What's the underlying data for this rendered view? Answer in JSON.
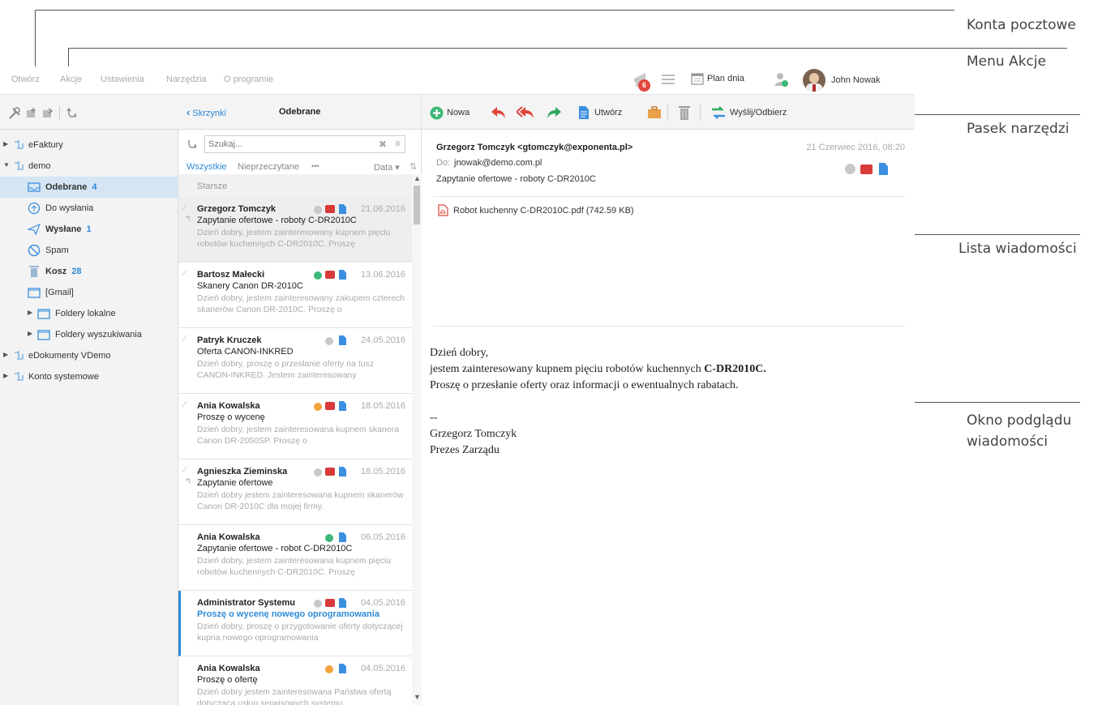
{
  "callouts": {
    "konta": "Konta pocztowe",
    "menu": "Menu Akcje",
    "pasek": "Pasek narzędzi",
    "lista": "Lista wiadomości",
    "okno_line1": "Okno podglądu",
    "okno_line2": "wiadomości"
  },
  "menu": [
    "Otwórz",
    "Akcje",
    "Ustawienia",
    "Narzędzia",
    "O programie"
  ],
  "header": {
    "notif_count": "6",
    "plan_label": "Plan dnia",
    "user_name": "John Nowak"
  },
  "list_header": {
    "back_label": "Skrzynki",
    "title": "Odebrane",
    "search_placeholder": "Szukaj...",
    "filter_all": "Wszystkie",
    "filter_unread": "Nieprzeczytane",
    "filter_more": "•••",
    "sort_label": "Data ▾",
    "group_label": "Starsze"
  },
  "tree": [
    {
      "label": "eFaktury",
      "count": ""
    },
    {
      "label": "demo",
      "count": ""
    },
    {
      "label": "Odebrane",
      "count": "4"
    },
    {
      "label": "Do wysłania",
      "count": ""
    },
    {
      "label": "Wysłane",
      "count": "1"
    },
    {
      "label": "Spam",
      "count": ""
    },
    {
      "label": "Kosz",
      "count": "28"
    },
    {
      "label": "[Gmail]",
      "count": ""
    },
    {
      "label": "Foldery lokalne",
      "count": ""
    },
    {
      "label": "Foldery wyszukiwania",
      "count": ""
    },
    {
      "label": "eDokumenty VDemo",
      "count": ""
    },
    {
      "label": "Konto systemowe",
      "count": ""
    }
  ],
  "messages": [
    {
      "from": "Grzegorz Tomczyk",
      "date": "21.06.2016",
      "subject": "Zapytanie ofertowe - roboty C-DR2010C",
      "preview": "Dzień dobry, jestem zainteresowany kupnem pięciu robotów kuchennych C-DR2010C. Proszę"
    },
    {
      "from": "Bartosz Małecki",
      "date": "13.06.2016",
      "subject": "Skanery Canon DR-2010C",
      "preview": "Dzień dobry, jestem zainteresowany zakupem czterech skanerów Canon DR-2010C. Proszę o"
    },
    {
      "from": "Patryk Kruczek",
      "date": "24.05.2016",
      "subject": "Oferta CANON-INKRED",
      "preview": "Dzień dobry, proszę o przesłanie oferty na tusz CANON-INKRED. Jestem zainteresowany"
    },
    {
      "from": "Ania Kowalska",
      "date": "18.05.2016",
      "subject": "Proszę o wycenę",
      "preview": "Dzień dobry, jestem zainteresowana kupnem skanera Canon DR-2050SP. Proszę o"
    },
    {
      "from": "Agnieszka Zieminska",
      "date": "18.05.2016",
      "subject": "Zapytanie ofertowe",
      "preview": "Dzień dobry jestem zainteresowana kupnem skanerów Canon DR-2010C dla mojej firmy."
    },
    {
      "from": "Ania Kowalska",
      "date": "06.05.2016",
      "subject": "Zapytanie ofertowe - robot C-DR2010C",
      "preview": "Dzień dobry, jestem zainteresowana kupnem pięciu robotów kuchennych C-DR2010C. Proszę"
    },
    {
      "from": "Administrator Systemu",
      "date": "04.05.2016",
      "subject": "Proszę o wycenę nowego oprogramowania",
      "preview": "Dzień dobry, proszę o przygotowanie oferty dotyczącej kupna nowego oprogramowania"
    },
    {
      "from": "Ania Kowalska",
      "date": "04.05.2016",
      "subject": "Proszę o ofertę",
      "preview": "Dzień dobry jestem zainteresowana Państwa ofertą dotyczącą usług serwisowych systemu."
    }
  ],
  "toolbar": {
    "new_label": "Nowa",
    "create_label": "Utwórz",
    "sendrecv_label": "Wyślij/Odbierz"
  },
  "preview": {
    "from": "Grzegorz Tomczyk <gtomczyk@exponenta.pl>",
    "date": "21 Czerwiec 2016, 08:20",
    "to_label": "Do:",
    "to": "jnowak@demo.com.pl",
    "subject": "Zapytanie ofertowe - roboty C-DR2010C",
    "attachment": "Robot kuchenny C-DR2010C.pdf (742.59 KB)",
    "body": {
      "greeting": "Dzień dobry,",
      "line1_pre": "jestem zainteresowany kupnem pięciu robotów kuchennych ",
      "line1_bold": "C-DR2010C.",
      "line2": "Proszę o przesłanie oferty oraz informacji o ewentualnych rabatach.",
      "sep": "--",
      "sig_name": "Grzegorz Tomczyk",
      "sig_title": "Prezes Zarządu"
    }
  },
  "colors": {
    "accent": "#2d8ad6",
    "selected_bg": "#d5e5f3",
    "red": "#e0443a",
    "green": "#3cb878",
    "orange": "#f3a33a"
  }
}
